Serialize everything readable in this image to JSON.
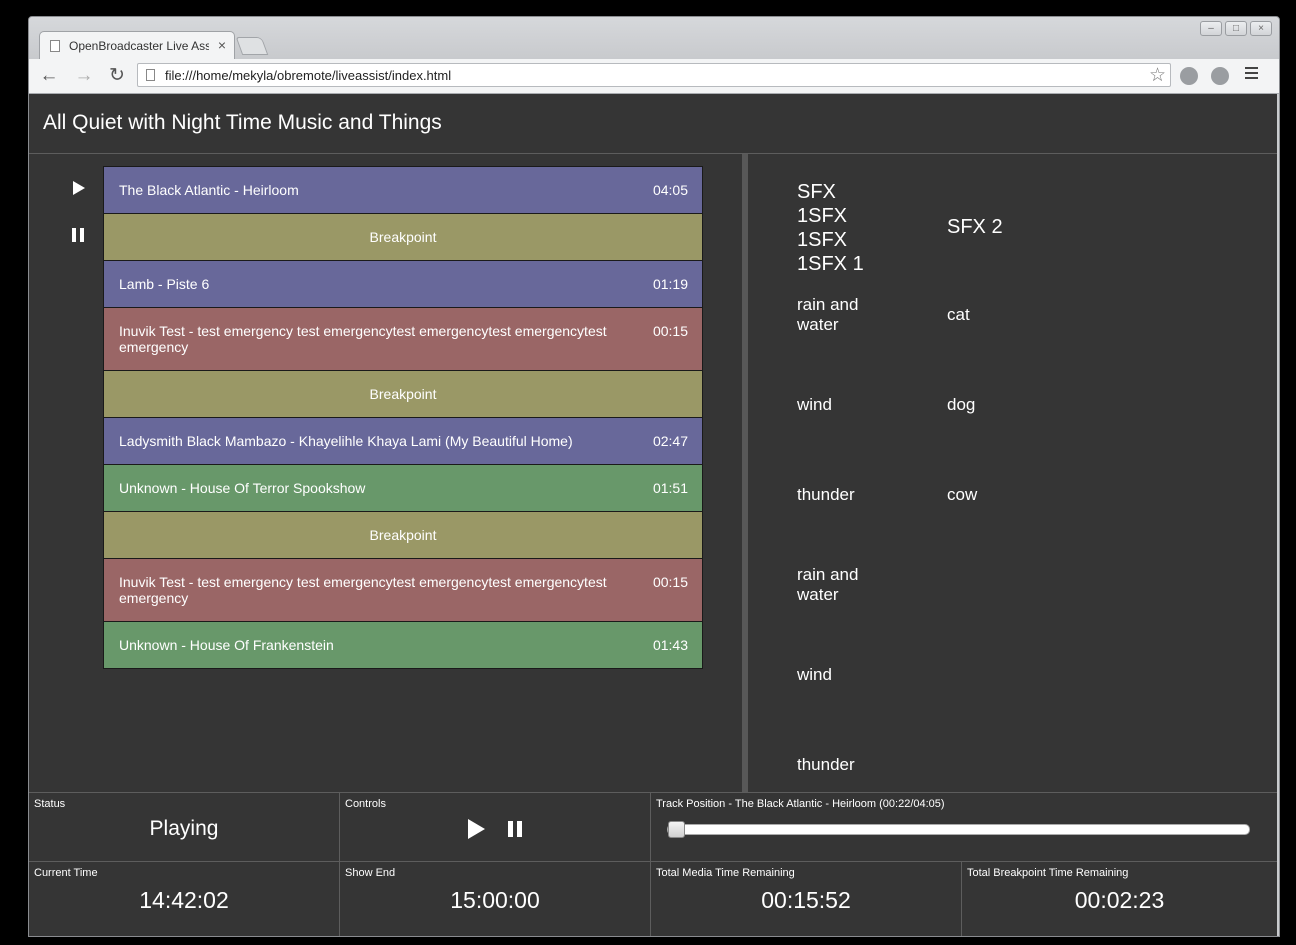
{
  "browser": {
    "tab_title": "OpenBroadcaster Live Assist",
    "tab_close": "×",
    "url": "file:///home/mekyla/obremote/liveassist/index.html"
  },
  "app": {
    "show_title": "All Quiet with Night Time Music and Things"
  },
  "colors": {
    "purple": "#68689a",
    "red": "#9a6666",
    "green": "#68986a",
    "olive": "#9a9866",
    "background": "#353535"
  },
  "playlist": [
    {
      "type": "track",
      "color": "purple",
      "title": "The Black Atlantic - Heirloom",
      "duration": "04:05"
    },
    {
      "type": "breakpoint",
      "color": "olive",
      "title": "Breakpoint"
    },
    {
      "type": "track",
      "color": "purple",
      "title": "Lamb - Piste 6",
      "duration": "01:19"
    },
    {
      "type": "track",
      "color": "red",
      "title": "Inuvik Test - test emergency test emergencytest emergencytest emergencytest emergency",
      "duration": "00:15"
    },
    {
      "type": "breakpoint",
      "color": "olive",
      "title": "Breakpoint"
    },
    {
      "type": "track",
      "color": "purple",
      "title": "Ladysmith Black Mambazo - Khayelihle Khaya Lami (My Beautiful Home)",
      "duration": "02:47"
    },
    {
      "type": "track",
      "color": "green",
      "title": "Unknown - House Of Terror Spookshow",
      "duration": "01:51"
    },
    {
      "type": "breakpoint",
      "color": "olive",
      "title": "Breakpoint"
    },
    {
      "type": "track",
      "color": "red",
      "title": "Inuvik Test - test emergency test emergencytest emergencytest emergencytest emergency",
      "duration": "00:15"
    },
    {
      "type": "track",
      "color": "green",
      "title": "Unknown - House Of Frankenstein",
      "duration": "01:43"
    }
  ],
  "sfx": {
    "col1_header": [
      "SFX",
      "1SFX",
      "1SFX",
      "1SFX 1"
    ],
    "col1_items": [
      "rain and water",
      "wind",
      "thunder",
      "rain and water",
      "wind",
      "thunder"
    ],
    "col2_header": "SFX 2",
    "col2_items": [
      "cat",
      "dog",
      "cow"
    ]
  },
  "status": {
    "status_label": "Status",
    "status_value": "Playing",
    "controls_label": "Controls",
    "track_position_label": "Track Position - The Black Atlantic - Heirloom (00:22/04:05)",
    "track_position_fraction": 0.0,
    "current_time_label": "Current Time",
    "current_time": "14:42:02",
    "show_end_label": "Show End",
    "show_end": "15:00:00",
    "media_remaining_label": "Total Media Time Remaining",
    "media_remaining": "00:15:52",
    "breakpoint_remaining_label": "Total Breakpoint Time Remaining",
    "breakpoint_remaining": "00:02:23"
  }
}
